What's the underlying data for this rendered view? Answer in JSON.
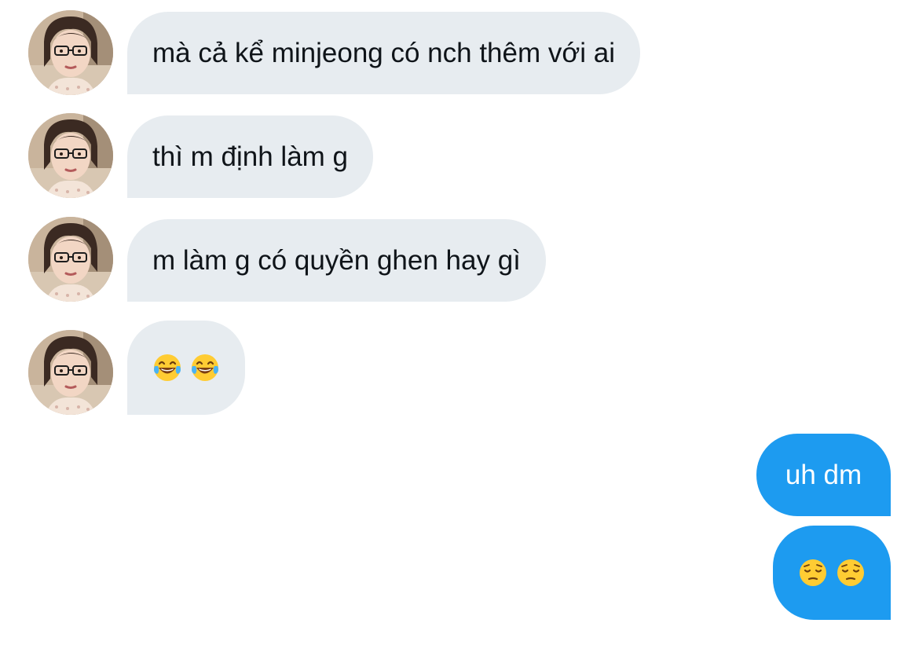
{
  "conversation": {
    "messages": [
      {
        "sender": "other",
        "text": "mà cả kể minjeong có nch thêm với ai"
      },
      {
        "sender": "other",
        "text": "thì m định làm g"
      },
      {
        "sender": "other",
        "text": "m làm g có quyền ghen hay gì"
      },
      {
        "sender": "other",
        "emoji": [
          "face-with-tears-of-joy",
          "face-with-tears-of-joy"
        ]
      },
      {
        "sender": "me",
        "text": "uh dm"
      },
      {
        "sender": "me",
        "emoji": [
          "pensive-face",
          "pensive-face"
        ]
      }
    ]
  },
  "colors": {
    "incoming_bubble": "#e7ecf0",
    "outgoing_bubble": "#1d9bf0",
    "incoming_text": "#0f1419",
    "outgoing_text": "#ffffff"
  }
}
